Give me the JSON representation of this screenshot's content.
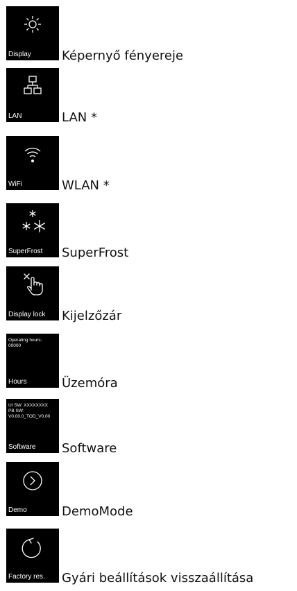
{
  "items": [
    {
      "tile_label": "Display",
      "label": "Képernyő fényereje",
      "icon": "sun-icon"
    },
    {
      "tile_label": "LAN",
      "label": "LAN *",
      "icon": "network-icon"
    },
    {
      "tile_label": "WiFi",
      "label": "WLAN *",
      "icon": "wifi-icon"
    },
    {
      "tile_label": "SuperFrost",
      "label": "SuperFrost",
      "icon": "snowflake-icon"
    },
    {
      "tile_label": "Display lock",
      "label": "Kijelzőzár",
      "icon": "touch-lock-icon"
    },
    {
      "tile_label": "Hours",
      "label": "Üzemóra",
      "tile_text": [
        "Operating hours:",
        "00000"
      ]
    },
    {
      "tile_label": "Software",
      "label": "Software",
      "tile_text": [
        "UI SW: XXXXXXXX",
        "PB SW:",
        "V0.00.0_TOD_V0.00"
      ]
    },
    {
      "tile_label": "Demo",
      "label": "DemoMode",
      "icon": "play-circle-icon"
    },
    {
      "tile_label": "Factory res.",
      "label": "Gyári beállítások visszaállítása",
      "icon": "reset-icon"
    }
  ]
}
